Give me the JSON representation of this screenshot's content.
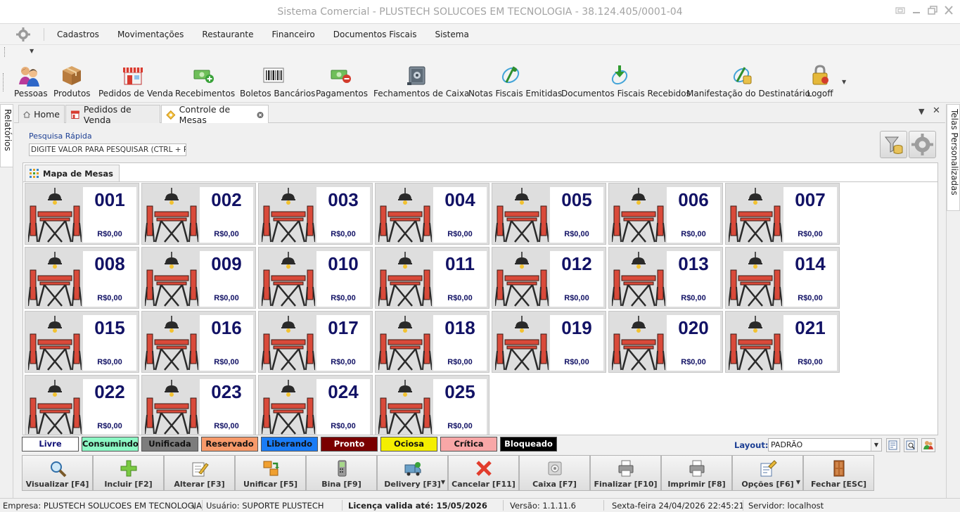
{
  "window": {
    "title": "Sistema  Comercial - PLUSTECH SOLUCOES EM TECNOLOGIA - 38.124.405/0001-04"
  },
  "menu": {
    "items": [
      "Cadastros",
      "Movimentações",
      "Restaurante",
      "Financeiro",
      "Documentos Fiscais",
      "Sistema"
    ]
  },
  "toolbar": {
    "items": [
      {
        "label": "Pessoas",
        "icon": "people-icon"
      },
      {
        "label": "Produtos",
        "icon": "box-icon"
      },
      {
        "label": "Pedidos de Venda",
        "icon": "store-icon"
      },
      {
        "label": "Recebimentos",
        "icon": "money-add-icon"
      },
      {
        "label": "Boletos Bancários",
        "icon": "barcode-icon"
      },
      {
        "label": "Pagamentos",
        "icon": "money-remove-icon"
      },
      {
        "label": "Fechamentos de Caixa",
        "icon": "safe-icon"
      },
      {
        "label": "Notas Fiscais Emitidas",
        "icon": "nfe-issued-icon"
      },
      {
        "label": "Documentos Fiscais Recebidos",
        "icon": "nfe-received-icon"
      },
      {
        "label": "Manifestação do Destinatário",
        "icon": "nfe-manifest-icon"
      },
      {
        "label": "Logoff",
        "icon": "lock-icon"
      }
    ]
  },
  "side": {
    "left_label": "Relatórios",
    "right_label": "Telas Personalizadas"
  },
  "tabs": [
    {
      "label": "Home",
      "icon": "home-icon"
    },
    {
      "label": "Pedidos de Venda",
      "icon": "store-icon"
    },
    {
      "label": "Controle de Mesas",
      "icon": "tables-icon"
    }
  ],
  "search": {
    "label": "Pesquisa Rápida",
    "value": "DIGITE VALOR PARA PESQUISAR (CTRL + P)"
  },
  "map": {
    "tab_label": "Mapa de Mesas",
    "tables": [
      {
        "number": "001",
        "value": "R$0,00"
      },
      {
        "number": "002",
        "value": "R$0,00"
      },
      {
        "number": "003",
        "value": "R$0,00"
      },
      {
        "number": "004",
        "value": "R$0,00"
      },
      {
        "number": "005",
        "value": "R$0,00"
      },
      {
        "number": "006",
        "value": "R$0,00"
      },
      {
        "number": "007",
        "value": "R$0,00"
      },
      {
        "number": "008",
        "value": "R$0,00"
      },
      {
        "number": "009",
        "value": "R$0,00"
      },
      {
        "number": "010",
        "value": "R$0,00"
      },
      {
        "number": "011",
        "value": "R$0,00"
      },
      {
        "number": "012",
        "value": "R$0,00"
      },
      {
        "number": "013",
        "value": "R$0,00"
      },
      {
        "number": "014",
        "value": "R$0,00"
      },
      {
        "number": "015",
        "value": "R$0,00"
      },
      {
        "number": "016",
        "value": "R$0,00"
      },
      {
        "number": "017",
        "value": "R$0,00"
      },
      {
        "number": "018",
        "value": "R$0,00"
      },
      {
        "number": "019",
        "value": "R$0,00"
      },
      {
        "number": "020",
        "value": "R$0,00"
      },
      {
        "number": "021",
        "value": "R$0,00"
      },
      {
        "number": "022",
        "value": "R$0,00"
      },
      {
        "number": "023",
        "value": "R$0,00"
      },
      {
        "number": "024",
        "value": "R$0,00"
      },
      {
        "number": "025",
        "value": "R$0,00"
      }
    ]
  },
  "legend": [
    {
      "label": "Livre",
      "bg": "#ffffff",
      "fg": "#111177"
    },
    {
      "label": "Consumindo",
      "bg": "#8cf7c4",
      "fg": "#111111"
    },
    {
      "label": "Unificada",
      "bg": "#7d7d7d",
      "fg": "#111111"
    },
    {
      "label": "Reservado",
      "bg": "#f79a6a",
      "fg": "#111111"
    },
    {
      "label": "Liberando",
      "bg": "#1a7cf5",
      "fg": "#111111"
    },
    {
      "label": "Pronto",
      "bg": "#7a0000",
      "fg": "#ffffff"
    },
    {
      "label": "Ociosa",
      "bg": "#f4ee00",
      "fg": "#111111"
    },
    {
      "label": "Crítica",
      "bg": "#f8a7a7",
      "fg": "#111111"
    },
    {
      "label": "Bloqueado",
      "bg": "#000000",
      "fg": "#ffffff"
    }
  ],
  "layout": {
    "label": "Layout:",
    "value": "PADRÃO"
  },
  "actions": [
    {
      "label": "Visualizar [F4]",
      "icon": "magnifier-icon",
      "dropdown": false
    },
    {
      "label": "Incluir [F2]",
      "icon": "plus-icon",
      "dropdown": false
    },
    {
      "label": "Alterar [F3]",
      "icon": "edit-icon",
      "dropdown": false
    },
    {
      "label": "Unificar [F5]",
      "icon": "merge-icon",
      "dropdown": false
    },
    {
      "label": "Bina [F9]",
      "icon": "phone-icon",
      "dropdown": false
    },
    {
      "label": "Delivery [F3]",
      "icon": "delivery-icon",
      "dropdown": true
    },
    {
      "label": "Cancelar [F11]",
      "icon": "cancel-icon",
      "dropdown": false
    },
    {
      "label": "Caixa [F7]",
      "icon": "cash-icon",
      "dropdown": false
    },
    {
      "label": "Finalizar [F10]",
      "icon": "printer-icon",
      "dropdown": false
    },
    {
      "label": "Imprimir [F8]",
      "icon": "printer-icon",
      "dropdown": false
    },
    {
      "label": "Opções [F6]",
      "icon": "options-icon",
      "dropdown": true
    },
    {
      "label": "Fechar [ESC]",
      "icon": "door-icon",
      "dropdown": false
    }
  ],
  "status": {
    "empresa": "Empresa: PLUSTECH SOLUCOES EM TECNOLOGIA",
    "sep": "\\",
    "usuario": "Usuário: SUPORTE PLUSTECH",
    "licenca": "Licença valida até: 15/05/2026",
    "versao": "Versão: 1.1.11.6",
    "data": "Sexta-feira 24/04/2026 22:45:21",
    "servidor": "Servidor: localhost"
  }
}
